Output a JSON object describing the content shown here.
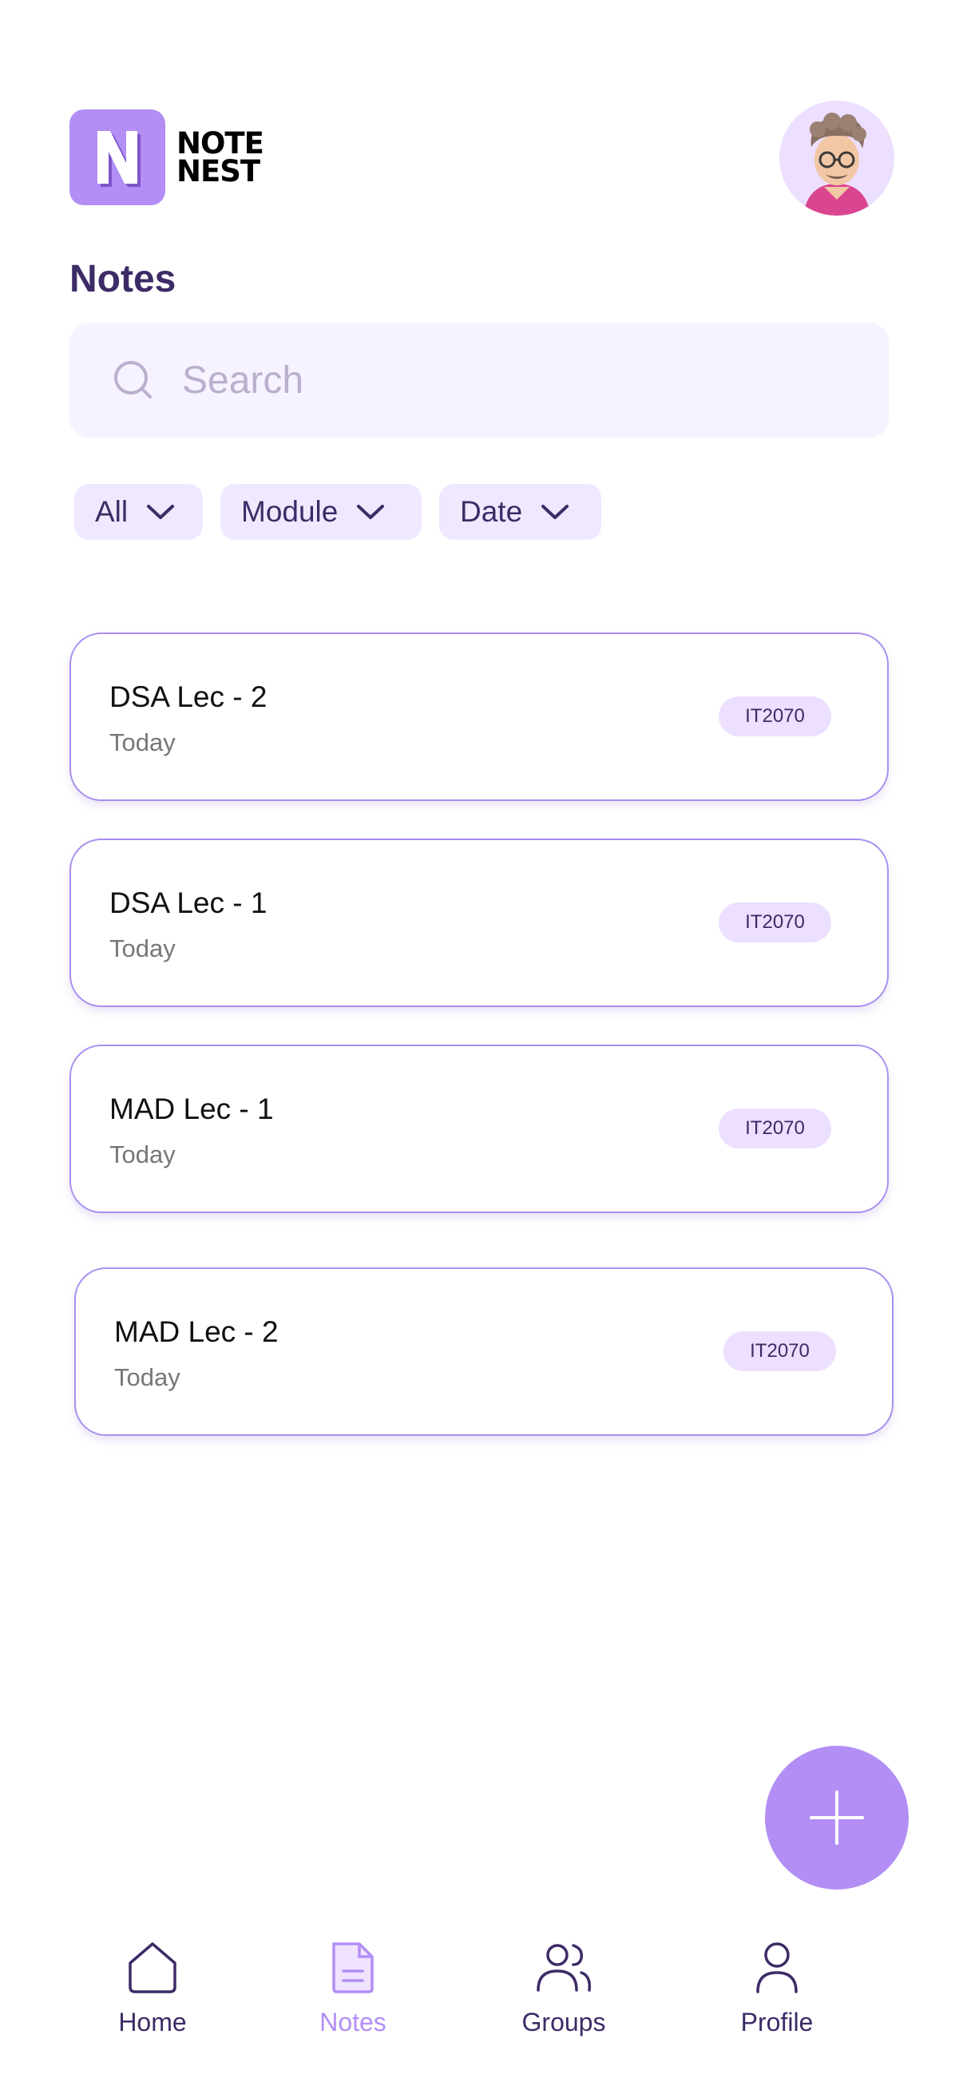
{
  "app": {
    "logo_line1": "NOTE",
    "logo_line2": "NEST",
    "logo_letter": "N"
  },
  "page": {
    "title": "Notes"
  },
  "search": {
    "placeholder": "Search"
  },
  "filters": [
    {
      "label": "All"
    },
    {
      "label": "Module"
    },
    {
      "label": "Date"
    }
  ],
  "notes": [
    {
      "title": "DSA Lec - 2",
      "date": "Today",
      "module": "IT2070"
    },
    {
      "title": "DSA Lec - 1",
      "date": "Today",
      "module": "IT2070"
    },
    {
      "title": "MAD Lec - 1",
      "date": "Today",
      "module": "IT2070"
    },
    {
      "title": "MAD Lec - 2",
      "date": "Today",
      "module": "IT2070"
    }
  ],
  "nav": [
    {
      "label": "Home",
      "icon": "home-icon",
      "active": false
    },
    {
      "label": "Notes",
      "icon": "document-icon",
      "active": true
    },
    {
      "label": "Groups",
      "icon": "users-icon",
      "active": false
    },
    {
      "label": "Profile",
      "icon": "user-icon",
      "active": false
    }
  ],
  "colors": {
    "accent": "#b28ef5",
    "chip_bg": "#efe8ff",
    "search_bg": "#f6f2ff",
    "text_dark": "#3d2b66"
  }
}
